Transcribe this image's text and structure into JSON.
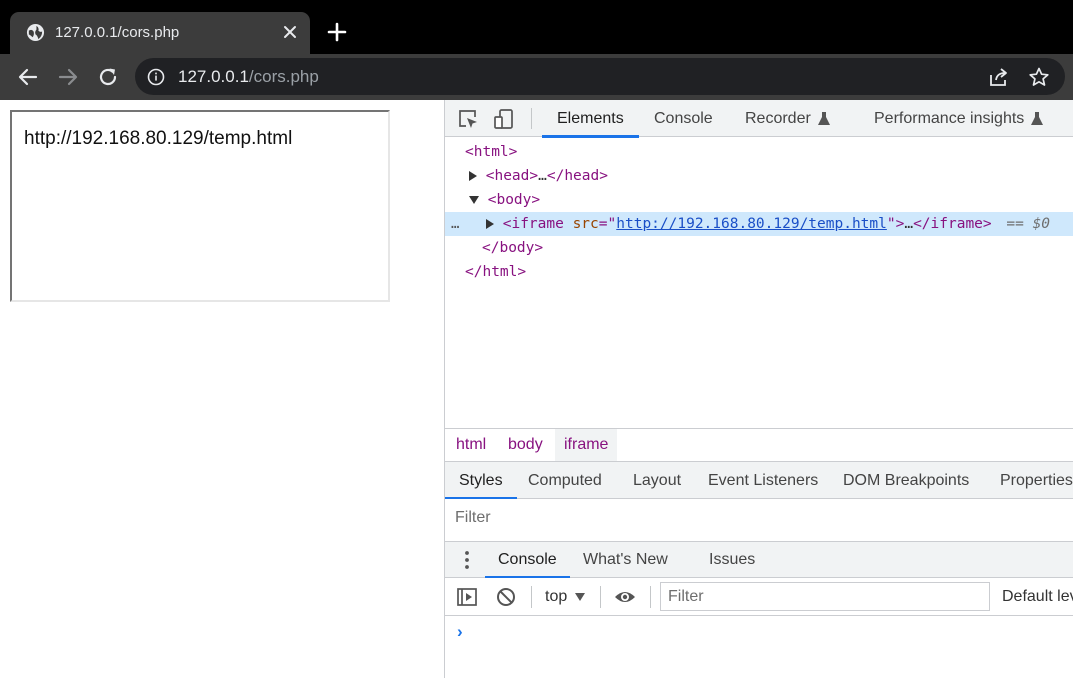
{
  "browser": {
    "tab_title": "127.0.0.1/cors.php",
    "url_host": "127.0.0.1",
    "url_path": "/cors.php",
    "icons": {
      "favicon": "globe-icon",
      "close": "close-icon",
      "new_tab": "plus-icon",
      "back": "back-arrow-icon",
      "forward": "forward-arrow-icon",
      "reload": "reload-icon",
      "site_info": "info-icon",
      "share": "share-icon",
      "bookmark": "star-icon"
    },
    "colors": {
      "tabstrip": "#000000",
      "toolbar": "#3c3c3c",
      "omnibox": "#202124"
    }
  },
  "page": {
    "iframe_text": "http://192.168.80.129/temp.html"
  },
  "devtools": {
    "tabs": [
      {
        "label": "Elements",
        "active": true
      },
      {
        "label": "Console"
      },
      {
        "label": "Recorder",
        "experimental": true
      },
      {
        "label": "Performance insights",
        "experimental": true
      }
    ],
    "dom": {
      "html_open": "<html>",
      "head_open": "<head>",
      "ellipsis": "…",
      "head_close": "</head>",
      "body_open": "<body>",
      "iframe_open": "<iframe",
      "iframe_attr_name": "src",
      "iframe_attr_eq": "=\"",
      "iframe_src": "http://192.168.80.129/temp.html",
      "iframe_attr_end": "\">",
      "iframe_close": "</iframe>",
      "selected_marker": "== $0",
      "dots": "…",
      "body_close": "</body>",
      "html_close": "</html>"
    },
    "breadcrumbs": [
      "html",
      "body",
      "iframe"
    ],
    "styles_tabs": [
      "Styles",
      "Computed",
      "Layout",
      "Event Listeners",
      "DOM Breakpoints",
      "Properties"
    ],
    "styles_filter_placeholder": "Filter",
    "drawer_tabs": [
      "Console",
      "What's New",
      "Issues"
    ],
    "console": {
      "context": "top",
      "filter_placeholder": "Filter",
      "levels_label": "Default levels",
      "prompt": "›"
    },
    "colors": {
      "accent": "#1a73e8",
      "tag": "#881280",
      "attr_name": "#994500",
      "link": "#1a4fc7",
      "selected_row": "#cfe8fc"
    }
  }
}
